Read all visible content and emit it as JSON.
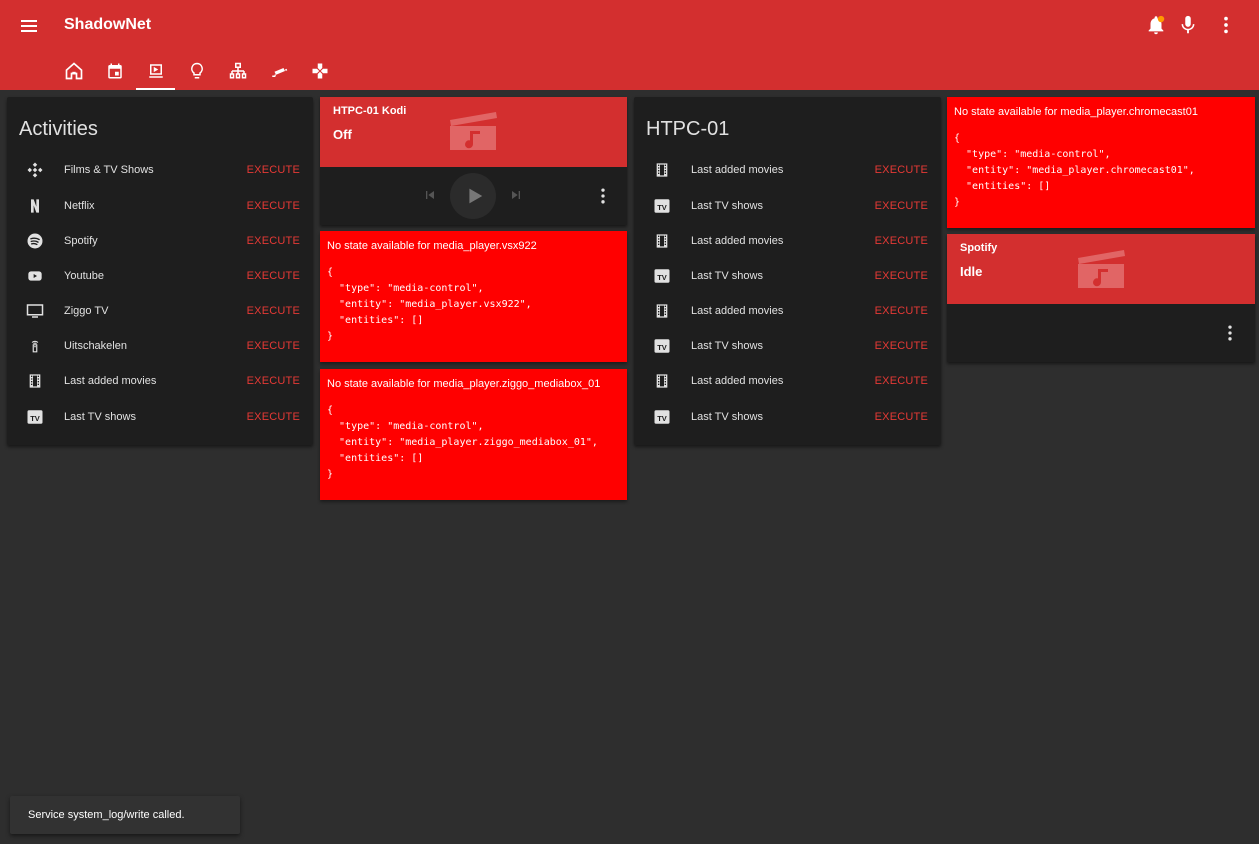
{
  "app": {
    "title": "ShadowNet"
  },
  "header": {
    "icons": [
      "menu-icon",
      "bell-icon",
      "microphone-icon",
      "dots-vertical-icon"
    ],
    "notification_dot_color": "#ff9800",
    "accent": "#d32f2f"
  },
  "tabs": [
    {
      "icon": "home-icon"
    },
    {
      "icon": "calendar-icon"
    },
    {
      "icon": "media-icon",
      "active": true
    },
    {
      "icon": "lightbulb-icon"
    },
    {
      "icon": "network-icon"
    },
    {
      "icon": "cctv-icon"
    },
    {
      "icon": "gamepad-icon"
    }
  ],
  "activities": {
    "title": "Activities",
    "items": [
      {
        "label": "Films & TV Shows",
        "icon": "kodi-icon",
        "action": "EXECUTE"
      },
      {
        "label": "Netflix",
        "icon": "netflix-icon",
        "action": "EXECUTE"
      },
      {
        "label": "Spotify",
        "icon": "spotify-icon",
        "action": "EXECUTE"
      },
      {
        "label": "Youtube",
        "icon": "youtube-icon",
        "action": "EXECUTE"
      },
      {
        "label": "Ziggo TV",
        "icon": "television-icon",
        "action": "EXECUTE"
      },
      {
        "label": "Uitschakelen",
        "icon": "remote-icon",
        "action": "EXECUTE"
      },
      {
        "label": "Last added movies",
        "icon": "filmstrip-icon",
        "action": "EXECUTE"
      },
      {
        "label": "Last TV shows",
        "icon": "tv-box-icon",
        "action": "EXECUTE"
      }
    ]
  },
  "htpc_kodi": {
    "name": "HTPC-01 Kodi",
    "state": "Off",
    "controls": [
      "skip-previous-icon",
      "play-icon",
      "skip-next-icon"
    ]
  },
  "errors": {
    "vsx922": {
      "title": "No state available for media_player.vsx922",
      "config": "{\n  \"type\": \"media-control\",\n  \"entity\": \"media_player.vsx922\",\n  \"entities\": []\n}"
    },
    "ziggo": {
      "title": "No state available for media_player.ziggo_mediabox_01",
      "config": "{\n  \"type\": \"media-control\",\n  \"entity\": \"media_player.ziggo_mediabox_01\",\n  \"entities\": []\n}"
    },
    "chromecast": {
      "title": "No state available for media_player.chromecast01",
      "config": "{\n  \"type\": \"media-control\",\n  \"entity\": \"media_player.chromecast01\",\n  \"entities\": []\n}"
    }
  },
  "htpc01": {
    "title": "HTPC-01",
    "items": [
      {
        "label": "Last added movies",
        "icon": "filmstrip-icon",
        "action": "EXECUTE"
      },
      {
        "label": "Last TV shows",
        "icon": "tv-box-icon",
        "action": "EXECUTE"
      },
      {
        "label": "Last added movies",
        "icon": "filmstrip-icon",
        "action": "EXECUTE"
      },
      {
        "label": "Last TV shows",
        "icon": "tv-box-icon",
        "action": "EXECUTE"
      },
      {
        "label": "Last added movies",
        "icon": "filmstrip-icon",
        "action": "EXECUTE"
      },
      {
        "label": "Last TV shows",
        "icon": "tv-box-icon",
        "action": "EXECUTE"
      },
      {
        "label": "Last added movies",
        "icon": "filmstrip-icon",
        "action": "EXECUTE"
      },
      {
        "label": "Last TV shows",
        "icon": "tv-box-icon",
        "action": "EXECUTE"
      }
    ]
  },
  "spotify": {
    "name": "Spotify",
    "state": "Idle"
  },
  "toast": {
    "message": "Service system_log/write called."
  }
}
